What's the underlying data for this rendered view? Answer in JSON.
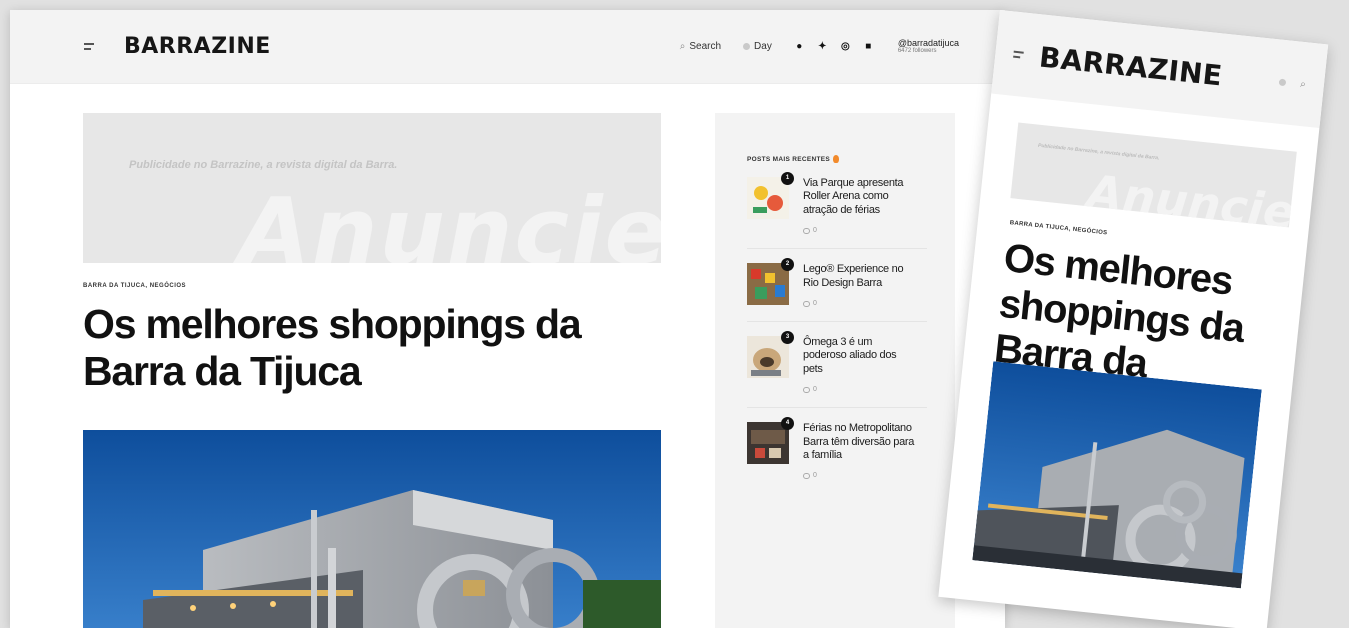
{
  "desktop": {
    "header": {
      "logo": "BARRAZINE",
      "search_label": "Search",
      "day_label": "Day",
      "handle": "@barradatijuca",
      "followers": "6472 followers"
    },
    "ad": {
      "tagline": "Publicidade no Barrazine, a revista digital da Barra.",
      "big_word": "Anuncie"
    },
    "article": {
      "category": "BARRA DA TIJUCA, NEGÓCIOS",
      "title": "Os melhores shoppings da Barra da Tijuca"
    },
    "sidebar": {
      "title": "POSTS MAIS RECENTES",
      "posts": [
        {
          "rank": "1",
          "title": "Via Parque apresenta Roller Arena como atração de férias",
          "comments": "0"
        },
        {
          "rank": "2",
          "title": "Lego® Experience no Rio Design Barra",
          "comments": "0"
        },
        {
          "rank": "3",
          "title": "Ômega 3 é um poderoso aliado dos pets",
          "comments": "0"
        },
        {
          "rank": "4",
          "title": "Férias no Metropolitano Barra têm diversão para a família",
          "comments": "0"
        }
      ]
    }
  },
  "mobile": {
    "logo": "BARRAZINE",
    "ad_tagline": "Publicidade no Barrazine, a revista digital da Barra.",
    "ad_big_word": "Anuncie",
    "category": "BARRA DA TIJUCA, NEGÓCIOS",
    "title": "Os melhores shoppings da Barra da Tijuca"
  },
  "icons": {
    "menu": "menu-icon",
    "search": "search-icon",
    "day": "sun-icon",
    "github": "github-icon",
    "twitter": "twitter-icon",
    "instagram": "instagram-icon",
    "youtube": "youtube-icon",
    "comment": "comment-icon",
    "fire": "fire-icon"
  },
  "colors": {
    "page_bg": "#e1e1e1",
    "header_bg": "#f3f3f3",
    "ad_bg": "#e7e7e7",
    "fire": "#f28a2b",
    "sky": "#1f5fa8"
  }
}
